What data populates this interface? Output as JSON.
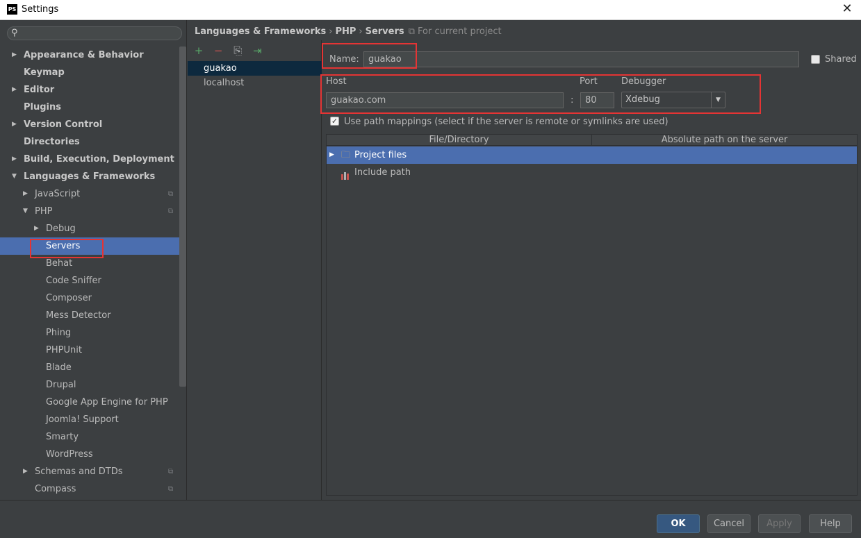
{
  "window": {
    "title": "Settings",
    "app_icon": "PS"
  },
  "search": {
    "placeholder": ""
  },
  "tree": [
    {
      "label": "Appearance & Behavior",
      "level": 0,
      "expanded": false,
      "bold": true
    },
    {
      "label": "Keymap",
      "level": 0,
      "bold": true
    },
    {
      "label": "Editor",
      "level": 0,
      "expanded": false,
      "bold": true
    },
    {
      "label": "Plugins",
      "level": 0,
      "bold": true
    },
    {
      "label": "Version Control",
      "level": 0,
      "expanded": false,
      "bold": true
    },
    {
      "label": "Directories",
      "level": 0,
      "bold": true
    },
    {
      "label": "Build, Execution, Deployment",
      "level": 0,
      "expanded": false,
      "bold": true
    },
    {
      "label": "Languages & Frameworks",
      "level": 0,
      "expanded": true,
      "bold": true
    },
    {
      "label": "JavaScript",
      "level": 1,
      "expanded": false,
      "project": true
    },
    {
      "label": "PHP",
      "level": 1,
      "expanded": true,
      "project": true
    },
    {
      "label": "Debug",
      "level": 2,
      "expanded": false
    },
    {
      "label": "Servers",
      "level": 2,
      "selected": true
    },
    {
      "label": "Behat",
      "level": 2
    },
    {
      "label": "Code Sniffer",
      "level": 2
    },
    {
      "label": "Composer",
      "level": 2
    },
    {
      "label": "Mess Detector",
      "level": 2
    },
    {
      "label": "Phing",
      "level": 2
    },
    {
      "label": "PHPUnit",
      "level": 2
    },
    {
      "label": "Blade",
      "level": 2
    },
    {
      "label": "Drupal",
      "level": 2
    },
    {
      "label": "Google App Engine for PHP",
      "level": 2
    },
    {
      "label": "Joomla! Support",
      "level": 2
    },
    {
      "label": "Smarty",
      "level": 2
    },
    {
      "label": "WordPress",
      "level": 2
    },
    {
      "label": "Schemas and DTDs",
      "level": 1,
      "expanded": false,
      "project": true
    },
    {
      "label": "Compass",
      "level": 1,
      "project": true
    }
  ],
  "breadcrumb": {
    "items": [
      "Languages & Frameworks",
      "PHP",
      "Servers"
    ],
    "separator": "›",
    "scope": "For current project"
  },
  "toolbar": {
    "add": "+",
    "remove": "−",
    "copy": "⎘",
    "import": "⇥"
  },
  "servers": [
    {
      "name": "guakao",
      "selected": true
    },
    {
      "name": "localhost",
      "selected": false
    }
  ],
  "form": {
    "name_label": "Name:",
    "name_value": "guakao",
    "shared_label": "Shared",
    "shared_checked": false,
    "host_label": "Host",
    "host_value": "guakao.com",
    "colon": ":",
    "port_label": "Port",
    "port_value": "80",
    "debugger_label": "Debugger",
    "debugger_value": "Xdebug",
    "path_mappings_label": "Use path mappings (select if the server is remote or symlinks are used)",
    "path_mappings_checked": true
  },
  "mappings": {
    "columns": [
      "File/Directory",
      "Absolute path on the server"
    ],
    "rows": [
      {
        "label": "Project files",
        "icon": "folder-icon",
        "selected": true
      },
      {
        "label": "Include path",
        "icon": "library-icon",
        "selected": false
      }
    ]
  },
  "buttons": {
    "ok": "OK",
    "cancel": "Cancel",
    "apply": "Apply",
    "help": "Help"
  },
  "colors": {
    "selection": "#4b6eaf",
    "background": "#3c3f41",
    "highlight_box": "#e53434",
    "ok_button": "#365880"
  }
}
